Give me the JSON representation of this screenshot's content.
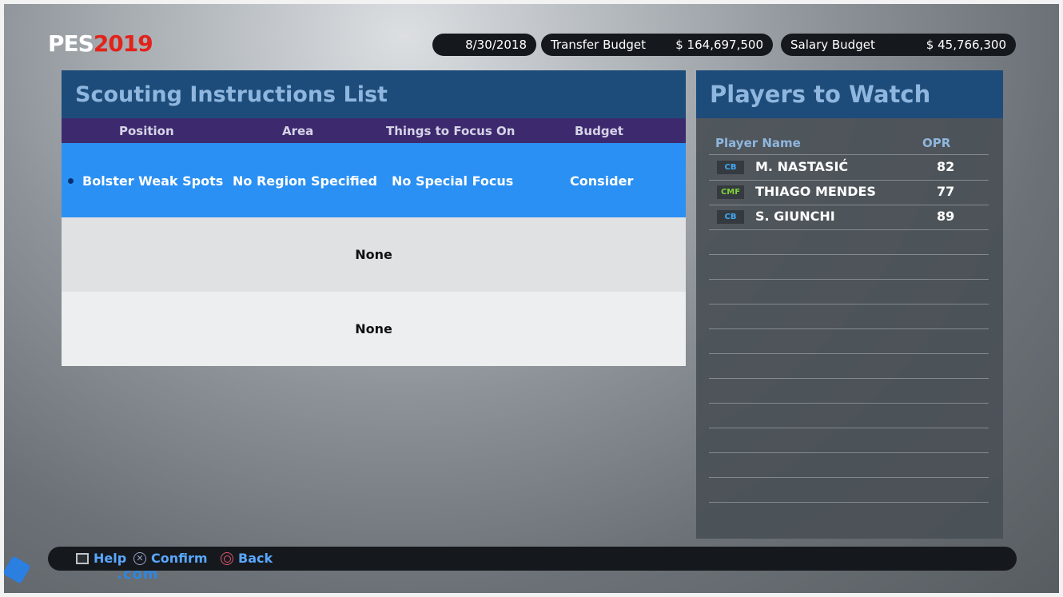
{
  "logo": {
    "pes": "PES",
    "year": "2019"
  },
  "status": {
    "date": "8/30/2018",
    "transfer_budget_label": "Transfer Budget",
    "transfer_budget_value": "$ 164,697,500",
    "salary_budget_label": "Salary Budget",
    "salary_budget_value": "$ 45,766,300"
  },
  "scouting": {
    "title": "Scouting Instructions List",
    "columns": [
      "Position",
      "Area",
      "Things to Focus On",
      "Budget"
    ],
    "rows": [
      {
        "position": "Bolster Weak Spots",
        "area": "No Region Specified",
        "focus": "No Special Focus",
        "budget": "Consider"
      }
    ],
    "empty_rows": [
      "None",
      "None"
    ]
  },
  "watch": {
    "title": "Players to Watch",
    "col_name": "Player Name",
    "col_opr": "OPR",
    "players": [
      {
        "pos": "CB",
        "name": "M. NASTASIĆ",
        "opr": "82"
      },
      {
        "pos": "CMF",
        "name": "THIAGO MENDES",
        "opr": "77"
      },
      {
        "pos": "CB",
        "name": "S. GIUNCHI",
        "opr": "89"
      }
    ]
  },
  "footer": {
    "help": "Help",
    "confirm": "Confirm",
    "back": "Back"
  },
  "watermark": {
    "text": ".com"
  },
  "colors": {
    "accent_blue": "#2b90f3",
    "header_blue": "#1d4c7a",
    "column_purple": "#3d2a6e",
    "pes_red": "#e2231a"
  }
}
